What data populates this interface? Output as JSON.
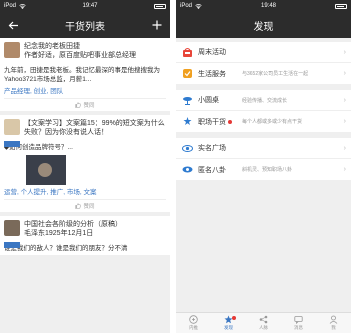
{
  "left": {
    "status": {
      "carrier": "iPod",
      "time": "19:47"
    },
    "nav": {
      "title": "干货列表"
    },
    "posts": [
      {
        "title": "纪念我的老板田捷",
        "subtitle": "作者好适，原百度贴吧事业部总经理",
        "body": "九年前，田捷是我老板。我记忆最深的事是他搜搜我为Yahoo3721市场总监，月薪1...",
        "tags": "产品经理, 创业, 团队",
        "like": "赞同",
        "avatar_color": "#b08a6a"
      },
      {
        "title": "【文案学习】文案篇15：99%的短文案为什么失败？因为你没有说人话！",
        "body": "◆如何创造品牌符号？...",
        "tags": "运营, 个人提升, 推广, 市场, 文案",
        "like": "赞同",
        "avatar_color": "#d9c7a8"
      },
      {
        "title": "中国社会各阶级的分析（原稿）",
        "subtitle": "毛泽东1925年12月1日",
        "body": "谁是我们的敌人？谁是我们的朋友？分不清",
        "avatar_color": "#7a6a5a"
      }
    ]
  },
  "right": {
    "status": {
      "carrier": "iPod",
      "time": "19:48"
    },
    "nav": {
      "title": "发现"
    },
    "groups": [
      [
        {
          "label": "周末活动",
          "desc": "",
          "icon": "weekend-icon"
        },
        {
          "label": "生活服务",
          "desc": "与3652家公司员工生活在一起",
          "icon": "life-service-icon"
        }
      ],
      [
        {
          "label": "小圆桌",
          "desc": "经验传播、交流成长",
          "icon": "round-table-icon"
        },
        {
          "label": "职场干货",
          "desc": "每个人都或多或少有点干货",
          "icon": "career-icon",
          "dot": true
        }
      ],
      [
        {
          "label": "实名广场",
          "desc": "",
          "icon": "real-name-icon"
        },
        {
          "label": "匿名八卦",
          "desc": "斜机灵、预知职场八卦",
          "icon": "anonymous-icon"
        }
      ]
    ],
    "tabs": [
      {
        "label": "内推",
        "icon": "referral-icon",
        "active": false
      },
      {
        "label": "发现",
        "icon": "discover-icon",
        "active": true,
        "badge": true
      },
      {
        "label": "人脉",
        "icon": "network-icon",
        "active": false
      },
      {
        "label": "消息",
        "icon": "message-icon",
        "active": false
      },
      {
        "label": "我",
        "icon": "profile-icon",
        "active": false
      }
    ]
  }
}
